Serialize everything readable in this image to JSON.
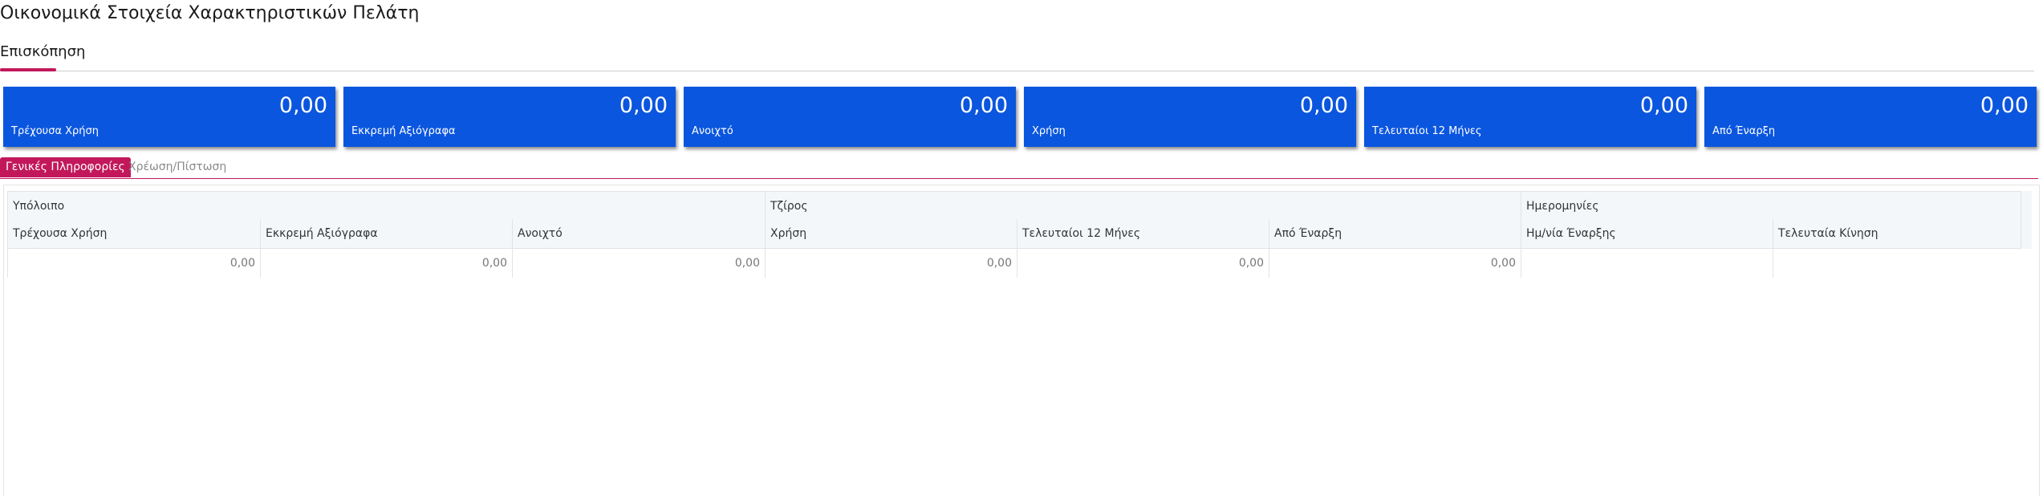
{
  "page": {
    "title": "Οικονομικά Στοιχεία Χαρακτηριστικών Πελάτη"
  },
  "main_tabs": [
    {
      "label": "Επισκόπηση",
      "active": true
    }
  ],
  "cards": [
    {
      "label": "Τρέχουσα Χρήση",
      "value": "0,00"
    },
    {
      "label": "Εκκρεμή Αξιόγραφα",
      "value": "0,00"
    },
    {
      "label": "Ανοιχτό",
      "value": "0,00"
    },
    {
      "label": "Χρήση",
      "value": "0,00"
    },
    {
      "label": "Τελευταίοι 12 Μήνες",
      "value": "0,00"
    },
    {
      "label": "Από Έναρξη",
      "value": "0,00"
    }
  ],
  "card_color": "#0b56df",
  "accent_color": "#c2185b",
  "sub_tabs": [
    {
      "label": "Γενικές Πληροφορίες",
      "active": true
    },
    {
      "label": "Χρέωση/Πίστωση",
      "active": false
    }
  ],
  "grid": {
    "groups": [
      "Υπόλοιπο",
      "Τζίρος",
      "Ημερομηνίες"
    ],
    "columns": [
      "Τρέχουσα Χρήση",
      "Εκκρεμή Αξιόγραφα",
      "Ανοιχτό",
      "Χρήση",
      "Τελευταίοι 12 Μήνες",
      "Από Έναρξη",
      "Ημ/νία Έναρξης",
      "Τελευταία Κίνηση"
    ],
    "rows": [
      [
        "0,00",
        "0,00",
        "0,00",
        "0,00",
        "0,00",
        "0,00",
        "",
        ""
      ]
    ]
  }
}
